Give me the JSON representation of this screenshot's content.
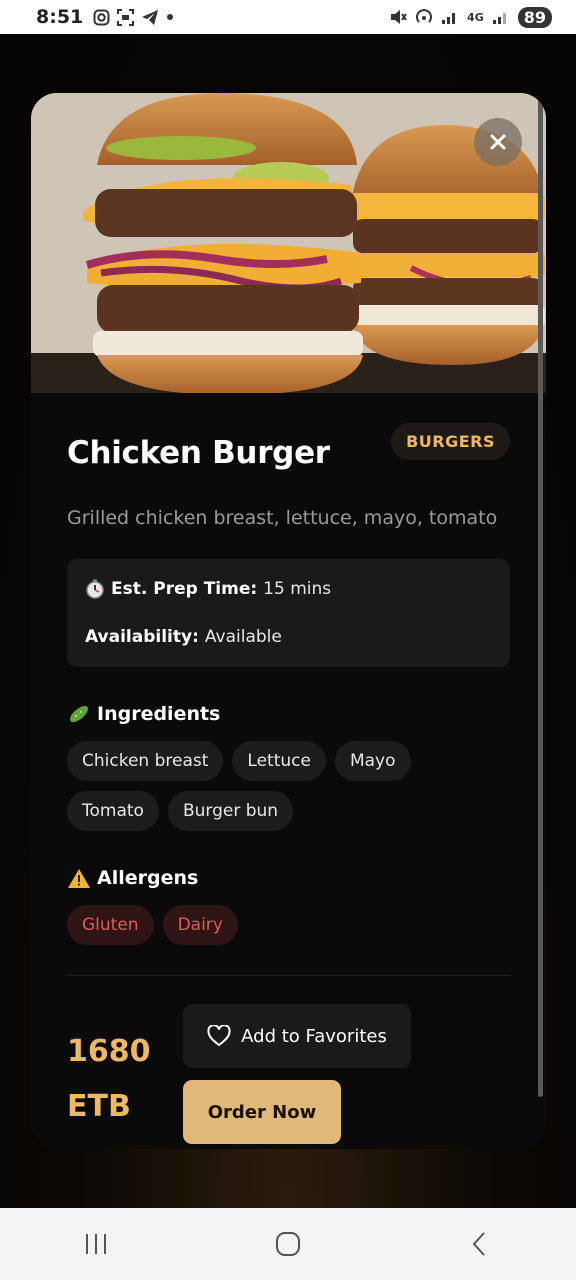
{
  "status_bar": {
    "time": "8:51",
    "battery": "89",
    "network": "4G"
  },
  "item": {
    "name": "Chicken Burger",
    "category": "BURGERS",
    "description": "Grilled chicken breast, lettuce, mayo, tomato",
    "prep_time_label": "Est. Prep Time:",
    "prep_time_value": "15 mins",
    "availability_label": "Availability:",
    "availability_value": "Available",
    "ingredients_title": "Ingredients",
    "ingredients": [
      "Chicken breast",
      "Lettuce",
      "Mayo",
      "Tomato",
      "Burger bun"
    ],
    "allergens_title": "Allergens",
    "allergens": [
      "Gluten",
      "Dairy"
    ],
    "price_amount": "1680",
    "price_currency": "ETB"
  },
  "actions": {
    "favorites_label": "Add to Favorites",
    "order_label": "Order Now"
  },
  "icons": {
    "timer": "stopwatch-icon",
    "ingredients": "cucumber-icon",
    "allergens": "warning-icon",
    "favorite": "heart-outline-icon",
    "close": "close-icon"
  },
  "colors": {
    "accent": "#f0b860",
    "allergen_text": "#e05a5a",
    "order_button": "#e0b978"
  }
}
